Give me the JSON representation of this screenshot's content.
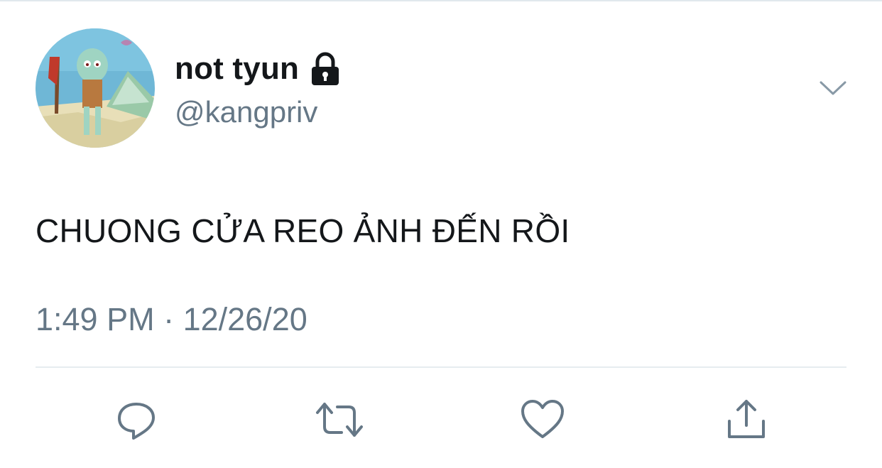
{
  "tweet": {
    "display_name": "not tyun",
    "handle": "@kangpriv",
    "text": "CHUONG CỬA REO ẢNH ĐẾN RỒI",
    "timestamp": "1:49 PM · 12/26/20",
    "protected": true
  },
  "icons": {
    "avatar": "avatar-image",
    "lock": "lock-icon",
    "menu": "chevron-down-icon",
    "reply": "reply-icon",
    "retweet": "retweet-icon",
    "like": "like-icon",
    "share": "share-icon"
  },
  "colors": {
    "text_primary": "#14171a",
    "text_secondary": "#657786",
    "icon": "#657786",
    "divider": "#e6ecf0"
  }
}
